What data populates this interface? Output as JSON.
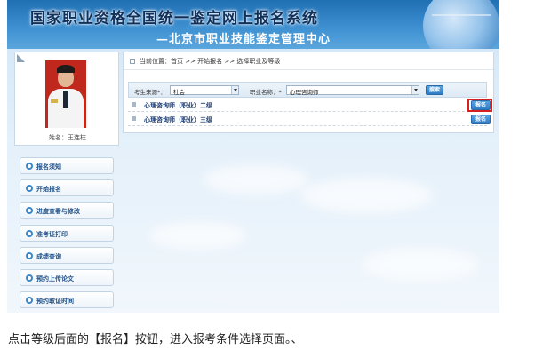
{
  "header": {
    "title": "国家职业资格全国统一鉴定网上报名系统",
    "subtitle": "—北京市职业技能鉴定管理中心"
  },
  "profile": {
    "name_text": "姓名：王连柱"
  },
  "nav": {
    "items": [
      {
        "label": "报名须知"
      },
      {
        "label": "开始报名"
      },
      {
        "label": "进度查看与修改"
      },
      {
        "label": "准考证打印"
      },
      {
        "label": "成绩查询"
      },
      {
        "label": "预约上传论文"
      },
      {
        "label": "预约取证时间"
      }
    ]
  },
  "breadcrumb": {
    "text": "当前位置：首页 >> 开始报名 >> 选择职业及等级"
  },
  "filter": {
    "source_label": "考生来源*：",
    "source_value": "社会",
    "occupation_label": "职业名称：*",
    "occupation_value": "心理咨询师",
    "search_label": "搜索"
  },
  "jobs": [
    {
      "name": "心理咨询师（职业）二级",
      "button": "报名"
    },
    {
      "name": "心理咨询师（职业）三级",
      "button": "报名"
    }
  ],
  "caption": "点击等级后面的【报名】按钮，进入报考条件选择页面。、",
  "colors": {
    "banner": "#2b7cc2",
    "button": "#2f7cc4",
    "highlight": "#d42020"
  }
}
